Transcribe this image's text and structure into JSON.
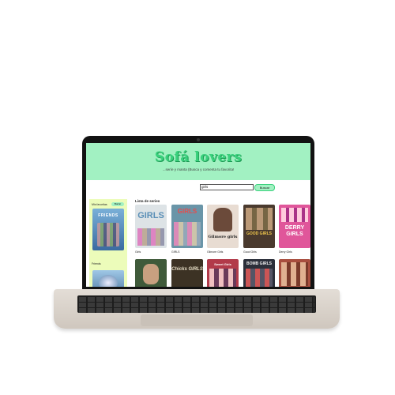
{
  "site": {
    "title": "Sofá lovers",
    "subtitle": "...seríe y manta (Busca y comenta tu favorita!"
  },
  "search": {
    "value": "girls",
    "button_label": "Buscar"
  },
  "sidebar": {
    "label": "Mis favoritas",
    "pill_label": "Borrar",
    "items": [
      {
        "title": "Friends",
        "poster_text": "FRIENDS",
        "color": "#3a6aa0"
      },
      {
        "title": "",
        "poster_text": "",
        "color": "#1e4d7a"
      }
    ]
  },
  "list": {
    "title": "Lista de series",
    "row1": [
      {
        "title": "Girls",
        "poster_text": "GIRLS",
        "color": "#dde3e6",
        "text_color": "#5a8fb7"
      },
      {
        "title": "GIRLS",
        "poster_text": "GIRLS",
        "color": "#6a95a8",
        "text_color": "#e84c4c"
      },
      {
        "title": "Gilmore Girls",
        "poster_text": "Gilmore girls",
        "color": "#e8dcd2",
        "text_color": "#222222"
      },
      {
        "title": "Good Girls",
        "poster_text": "GOOD GIRLS",
        "color": "#4a3a2e",
        "text_color": "#f2c94c"
      },
      {
        "title": "Derry Girls",
        "poster_text": "DERRY GIRLS",
        "color": "#e0569a",
        "text_color": "#ffffff"
      }
    ],
    "row2": [
      {
        "title": "",
        "poster_text": "",
        "color": "#3f5a3a",
        "text_color": "#ffffff"
      },
      {
        "title": "",
        "poster_text": "Chicks GIRLS",
        "color": "#3c3224",
        "text_color": "#e8e0c8"
      },
      {
        "title": "",
        "poster_text": "Sweet Girls",
        "color": "#b23a4a",
        "text_color": "#ffffff"
      },
      {
        "title": "",
        "poster_text": "BOMB GIRLS",
        "color": "#2b2f3a",
        "text_color": "#f0f0f0"
      },
      {
        "title": "",
        "poster_text": "",
        "color": "#a84e3e",
        "text_color": "#ffffff"
      }
    ]
  }
}
